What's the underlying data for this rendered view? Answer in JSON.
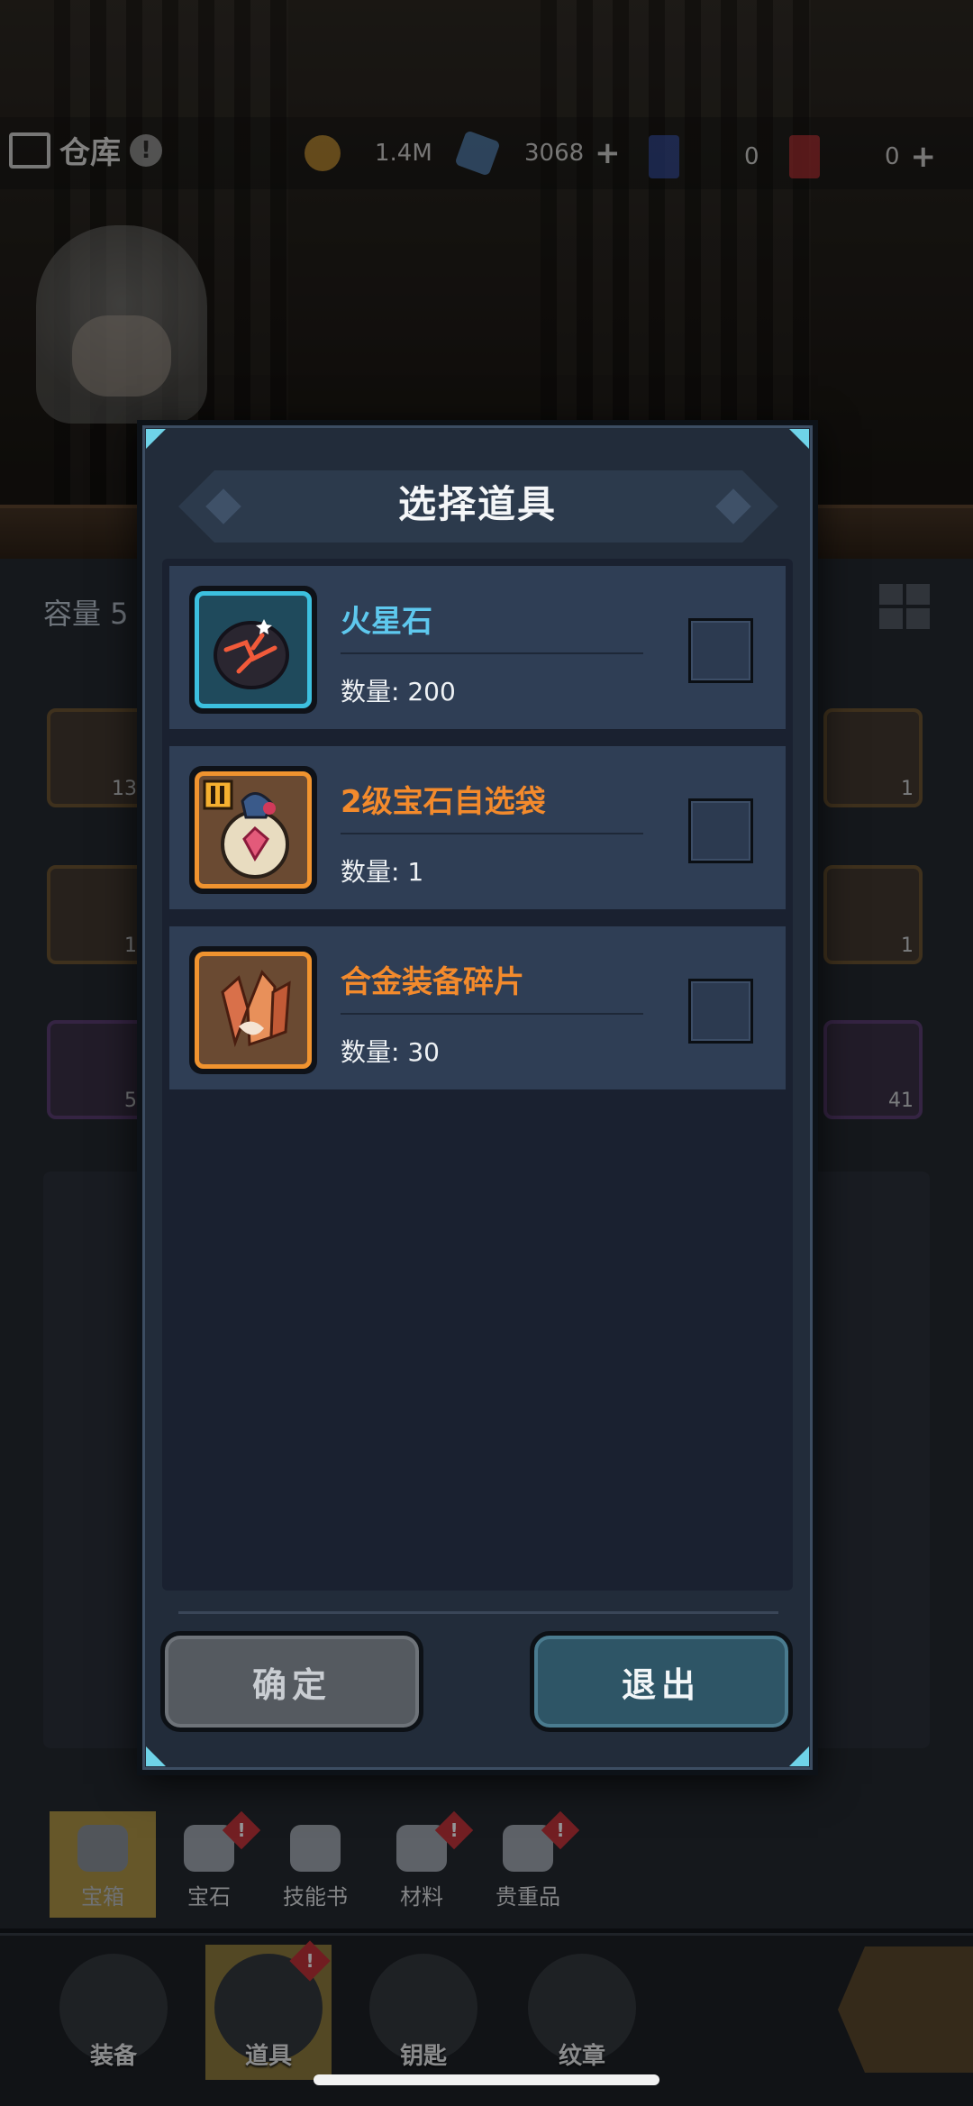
{
  "header": {
    "title": "仓库",
    "resources": [
      {
        "icon": "gold-coin-icon",
        "value": "1.4M"
      },
      {
        "icon": "blue-crystal-icon",
        "value": "3068"
      },
      {
        "icon": "blue-card-icon",
        "value": "0"
      },
      {
        "icon": "red-card-icon",
        "value": "0"
      }
    ]
  },
  "background": {
    "capacity_label": "容量 5",
    "slots": [
      "13",
      "1",
      "5",
      "1",
      "1",
      "41"
    ]
  },
  "modal": {
    "title": "选择道具",
    "items": [
      {
        "name": "火星石",
        "quantity": "数量: 200",
        "color": "#5ec8ee",
        "frame": "blue",
        "icon": "fire-stone-icon",
        "selected": false
      },
      {
        "name": "2级宝石自选袋",
        "quantity": "数量: 1",
        "color": "#f38a2c",
        "frame": "orange",
        "icon": "gem-bag-icon",
        "selected": false
      },
      {
        "name": "合金装备碎片",
        "quantity": "数量: 30",
        "color": "#f38a2c",
        "frame": "orange",
        "icon": "alloy-shard-icon",
        "selected": false
      }
    ],
    "confirm_label": "确定",
    "exit_label": "退出"
  },
  "subtabs": [
    {
      "label": "宝箱",
      "active": true,
      "alert": false
    },
    {
      "label": "宝石",
      "active": false,
      "alert": true
    },
    {
      "label": "技能书",
      "active": false,
      "alert": false
    },
    {
      "label": "材料",
      "active": false,
      "alert": true
    },
    {
      "label": "贵重品",
      "active": false,
      "alert": true
    }
  ],
  "nav": [
    {
      "label": "装备",
      "active": false,
      "alert": false
    },
    {
      "label": "道具",
      "active": true,
      "alert": true
    },
    {
      "label": "钥匙",
      "active": false,
      "alert": false
    },
    {
      "label": "纹章",
      "active": false,
      "alert": false
    }
  ]
}
